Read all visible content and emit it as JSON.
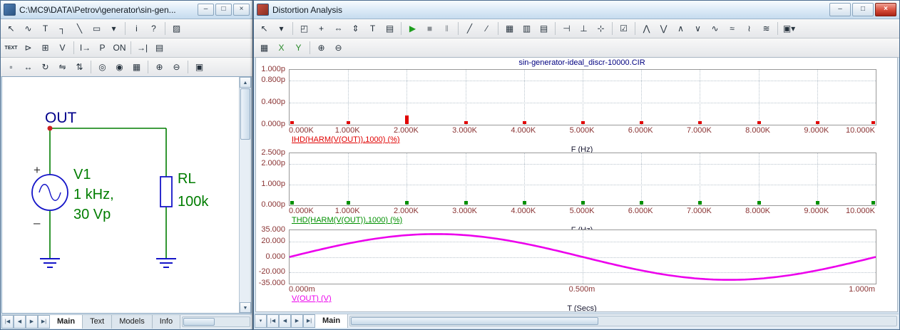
{
  "left_window": {
    "title": "C:\\MC9\\DATA\\Petrov\\generator\\sin-gen...",
    "window_buttons": [
      {
        "name": "minimize-button",
        "glyph": "–"
      },
      {
        "name": "restore-button",
        "glyph": "□"
      },
      {
        "name": "close-button",
        "glyph": "×"
      }
    ],
    "toolbar1": [
      {
        "name": "select-icon",
        "glyph": "↖"
      },
      {
        "name": "component-icon",
        "glyph": "∿"
      },
      {
        "name": "text-tool-icon",
        "glyph": "T"
      },
      {
        "name": "wire-tool-icon",
        "glyph": "┐"
      },
      {
        "name": "diagonal-wire-icon",
        "glyph": "╲"
      },
      {
        "name": "graphics-tool-icon",
        "glyph": "▭"
      },
      {
        "name": "shapes-dropdown-icon",
        "glyph": "▾"
      },
      {
        "sep": true
      },
      {
        "name": "info-icon",
        "glyph": "i"
      },
      {
        "name": "help-mode-icon",
        "glyph": "?"
      },
      {
        "sep": true
      },
      {
        "name": "find-part-icon",
        "glyph": "▨"
      }
    ],
    "toolbar2": [
      {
        "name": "text-attributes-icon",
        "glyph": "TEXT"
      },
      {
        "name": "flag-icon",
        "glyph": "⊳"
      },
      {
        "name": "node-numbers-icon",
        "glyph": "⊞"
      },
      {
        "name": "node-voltages-icon",
        "glyph": "V"
      },
      {
        "sep": true
      },
      {
        "name": "currents-icon",
        "glyph": "I→"
      },
      {
        "name": "powers-icon",
        "glyph": "P"
      },
      {
        "name": "conditions-icon",
        "glyph": "ON"
      },
      {
        "sep": true
      },
      {
        "name": "pin-connections-icon",
        "glyph": "→|"
      },
      {
        "name": "grid-text-icon",
        "glyph": "▤"
      }
    ],
    "toolbar3": [
      {
        "name": "clipboard-icon",
        "glyph": "▫"
      },
      {
        "name": "move-icon",
        "glyph": "↔"
      },
      {
        "name": "rotate-icon",
        "glyph": "↻"
      },
      {
        "name": "flip-horizontal-icon",
        "glyph": "⇋"
      },
      {
        "name": "flip-vertical-icon",
        "glyph": "⇅"
      },
      {
        "sep": true
      },
      {
        "name": "find-icon",
        "glyph": "◎"
      },
      {
        "name": "find-repeat-icon",
        "glyph": "◉"
      },
      {
        "name": "grid-icon",
        "glyph": "▦"
      },
      {
        "sep": true
      },
      {
        "name": "zoom-in-icon",
        "glyph": "⊕"
      },
      {
        "name": "zoom-out-icon",
        "glyph": "⊖"
      },
      {
        "sep": true
      },
      {
        "name": "image-icon",
        "glyph": "▣"
      }
    ],
    "schematic": {
      "node_label": "OUT",
      "source_name": "V1",
      "source_value1": "1 kHz,",
      "source_value2": "30 Vp",
      "plus": "+",
      "minus": "–",
      "resistor_name": "RL",
      "resistor_value": "100k",
      "wire_color": "#007d00",
      "component_color": "#1414c8",
      "label_color": "#007d00",
      "node_label_color": "#00008b",
      "node_dot_color": "#cc2020"
    },
    "tab_nav": [
      {
        "name": "first-page-button",
        "glyph": "|◀"
      },
      {
        "name": "prev-page-button",
        "glyph": "◀"
      },
      {
        "name": "next-page-button",
        "glyph": "▶"
      },
      {
        "name": "last-page-button",
        "glyph": "▶|"
      }
    ],
    "tabs": [
      {
        "label": "Main",
        "active": true
      },
      {
        "label": "Text",
        "active": false
      },
      {
        "label": "Models",
        "active": false
      },
      {
        "label": "Info",
        "active": false
      }
    ]
  },
  "right_window": {
    "title": "Distortion Analysis",
    "window_buttons": [
      {
        "name": "minimize-button",
        "glyph": "–"
      },
      {
        "name": "maximize-button",
        "glyph": "□"
      },
      {
        "name": "close-button",
        "glyph": "×"
      }
    ],
    "toolbar1": [
      {
        "name": "select-icon",
        "glyph": "↖"
      },
      {
        "name": "shape-tools-dropdown-icon",
        "glyph": "▾"
      },
      {
        "sep": true
      },
      {
        "name": "scale-mode-icon",
        "glyph": "◰"
      },
      {
        "name": "cursor-mode-icon",
        "glyph": "+"
      },
      {
        "name": "measure-horizontal-icon",
        "glyph": "⇔"
      },
      {
        "name": "measure-vertical-icon",
        "glyph": "⇕"
      },
      {
        "name": "text-mode-icon",
        "glyph": "T"
      },
      {
        "name": "properties-icon",
        "glyph": "▤"
      },
      {
        "sep": true
      },
      {
        "name": "run-icon",
        "glyph": "▶",
        "color": "#1f9e1f"
      },
      {
        "name": "stop-icon",
        "glyph": "■",
        "color": "#8a8f94"
      },
      {
        "name": "pause-icon",
        "glyph": "‖",
        "color": "#8a8f94"
      },
      {
        "sep": true
      },
      {
        "name": "line-tool-icon",
        "glyph": "╱"
      },
      {
        "name": "tag-line-icon",
        "glyph": "∕"
      },
      {
        "sep": true
      },
      {
        "name": "data-points-icon",
        "glyph": "▦"
      },
      {
        "name": "tokens-icon",
        "glyph": "▥"
      },
      {
        "name": "ruler-icon",
        "glyph": "▤"
      },
      {
        "sep": true
      },
      {
        "name": "horizontal-tag-icon",
        "glyph": "⊣"
      },
      {
        "name": "vertical-tag-icon",
        "glyph": "⊥"
      },
      {
        "name": "tracker-icon",
        "glyph": "⊹"
      },
      {
        "sep": true
      },
      {
        "name": "align-cursors-icon",
        "glyph": "☑"
      },
      {
        "sep": true
      },
      {
        "name": "peak-icon",
        "glyph": "⋀"
      },
      {
        "name": "valley-icon",
        "glyph": "⋁"
      },
      {
        "name": "high-icon",
        "glyph": "∧"
      },
      {
        "name": "low-icon",
        "glyph": "∨"
      },
      {
        "name": "inflection-icon",
        "glyph": "∿"
      },
      {
        "name": "global-high-icon",
        "glyph": "≈"
      },
      {
        "name": "global-low-icon",
        "glyph": "≀"
      },
      {
        "name": "next-waveform-icon",
        "glyph": "≋"
      },
      {
        "sep": true
      },
      {
        "name": "color-pages-dropdown-icon",
        "glyph": "▣▾"
      }
    ],
    "toolbar2": [
      {
        "name": "numeric-output-icon",
        "glyph": "▦"
      },
      {
        "name": "go-to-x-icon",
        "glyph": "X",
        "color": "#2a8a2a"
      },
      {
        "name": "go-to-y-icon",
        "glyph": "Y",
        "color": "#2a8a2a"
      },
      {
        "sep": true
      },
      {
        "name": "zoom-in-icon",
        "glyph": "⊕"
      },
      {
        "name": "zoom-out-icon",
        "glyph": "⊖"
      }
    ],
    "plot_style": {
      "tick_color": "#8a3333",
      "grid_color": "#b9c4cd",
      "title_color": "#000080",
      "box_border": "#999999",
      "axis_label_color": "#14142e"
    },
    "tab_nav": [
      {
        "name": "tab-list-dropdown",
        "glyph": "▾"
      },
      {
        "name": "first-page-button",
        "glyph": "|◀"
      },
      {
        "name": "prev-page-button",
        "glyph": "◀"
      },
      {
        "name": "next-page-button",
        "glyph": "▶"
      },
      {
        "name": "last-page-button",
        "glyph": "▶|"
      }
    ],
    "tabs": [
      {
        "label": "Main",
        "active": true
      }
    ]
  },
  "chart_data": [
    {
      "type": "bar",
      "title": "sin-generator-ideal_discr-10000.CIR",
      "series_label": "IHD(HARM(V(OUT)),1000) (%)",
      "color": "#e00000",
      "xlabel": "F (Hz)",
      "x_ticks": [
        "0.000K",
        "1.000K",
        "2.000K",
        "3.000K",
        "4.000K",
        "5.000K",
        "6.000K",
        "7.000K",
        "8.000K",
        "9.000K",
        "10.000K"
      ],
      "x_values": [
        0,
        1000,
        2000,
        3000,
        4000,
        5000,
        6000,
        7000,
        8000,
        9000,
        10000
      ],
      "y_ticks": [
        {
          "v": 1.0,
          "label": "1.000p"
        },
        {
          "v": 0.8,
          "label": "0.800p"
        },
        {
          "v": 0.4,
          "label": "0.400p"
        },
        {
          "v": 0.0,
          "label": "0.000p"
        }
      ],
      "ylim": [
        0,
        1.0
      ],
      "y_unit": "p",
      "values": [
        0.05,
        0.05,
        0.15,
        0.05,
        0.05,
        0.05,
        0.05,
        0.05,
        0.05,
        0.05,
        0.05
      ],
      "grid": true
    },
    {
      "type": "bar",
      "series_label": "THD(HARM(V(OUT)),1000) (%)",
      "color": "#009000",
      "xlabel": "F (Hz)",
      "x_ticks": [
        "0.000K",
        "1.000K",
        "2.000K",
        "3.000K",
        "4.000K",
        "5.000K",
        "6.000K",
        "7.000K",
        "8.000K",
        "9.000K",
        "10.000K"
      ],
      "x_values": [
        0,
        1000,
        2000,
        3000,
        4000,
        5000,
        6000,
        7000,
        8000,
        9000,
        10000
      ],
      "y_ticks": [
        {
          "v": 2.5,
          "label": "2.500p"
        },
        {
          "v": 2.0,
          "label": "2.000p"
        },
        {
          "v": 1.0,
          "label": "1.000p"
        },
        {
          "v": 0.0,
          "label": "0.000p"
        }
      ],
      "ylim": [
        0,
        2.5
      ],
      "y_unit": "p",
      "values": [
        0.18,
        0.18,
        0.18,
        0.18,
        0.18,
        0.18,
        0.18,
        0.18,
        0.18,
        0.18,
        0.18
      ],
      "grid": true
    },
    {
      "type": "line",
      "series_label": "V(OUT) (V)",
      "color": "#ec00ec",
      "xlabel": "T (Secs)",
      "x_ticks": [
        "0.000m",
        "0.500m",
        "1.000m"
      ],
      "x_fracs": [
        0,
        0.5,
        1
      ],
      "y_ticks": [
        {
          "v": 35,
          "label": "35.000"
        },
        {
          "v": 20,
          "label": "20.000"
        },
        {
          "v": 0,
          "label": "0.000"
        },
        {
          "v": -20,
          "label": "-20.000"
        },
        {
          "v": -35,
          "label": "-35.000"
        }
      ],
      "ylim": [
        -35,
        35
      ],
      "sine": {
        "amplitude": 30,
        "periods": 1,
        "t_range_ms": [
          0,
          1
        ]
      },
      "grid": true
    }
  ]
}
